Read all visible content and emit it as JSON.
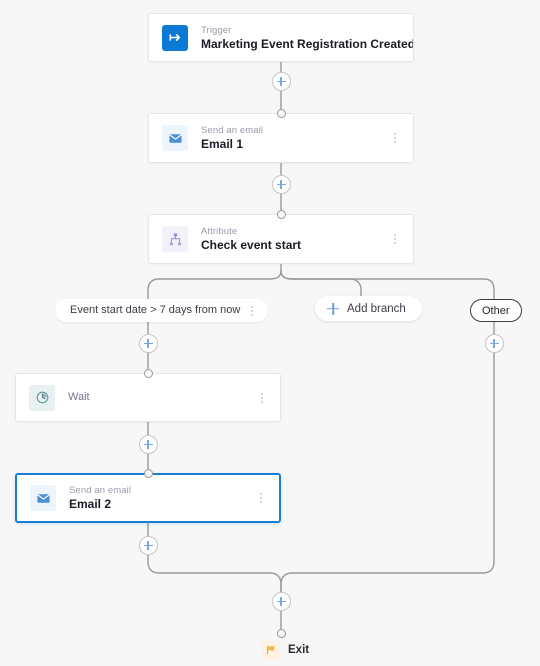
{
  "canvas": {
    "background": "#f7f7f7",
    "accent": "#0a7ad4",
    "plus_color": "#7ba7e0",
    "connector_color": "#9a9a9a"
  },
  "nodes": [
    {
      "id": "trigger",
      "kind": "Trigger",
      "title": "Marketing Event Registration Created",
      "icon": "trigger-arrow-icon",
      "icon_bg": "#0a7ad4",
      "has_kebab": false,
      "selected": false
    },
    {
      "id": "email-1",
      "kind": "Send an email",
      "title": "Email 1",
      "icon": "envelope-icon",
      "icon_bg": "#eef4fb",
      "has_kebab": true,
      "selected": false
    },
    {
      "id": "attribute",
      "kind": "Attribute",
      "title": "Check event start",
      "icon": "hierarchy-icon",
      "icon_bg": "#f2f1fa",
      "has_kebab": true,
      "selected": false
    },
    {
      "id": "wait",
      "kind": "",
      "title": "Wait",
      "icon": "clock-icon",
      "icon_bg": "#e7f1f1",
      "has_kebab": true,
      "selected": false
    },
    {
      "id": "email-2",
      "kind": "Send an email",
      "title": "Email 2",
      "icon": "envelope-icon",
      "icon_bg": "#eef4fb",
      "has_kebab": true,
      "selected": true
    }
  ],
  "branches": {
    "condition_label": "Event start date > 7 days from now",
    "add_branch_label": "Add branch",
    "other_label": "Other"
  },
  "exit": {
    "label": "Exit",
    "icon": "flag-icon",
    "icon_bg": "#fdf3e0",
    "flag_color": "#f0a530"
  },
  "add_step_buttons": [
    {
      "name": "add-step-after-trigger"
    },
    {
      "name": "add-step-after-email-1"
    },
    {
      "name": "add-step-after-condition-branch"
    },
    {
      "name": "add-step-after-wait"
    },
    {
      "name": "add-step-after-email-2"
    },
    {
      "name": "add-step-after-other-branch"
    },
    {
      "name": "add-step-before-exit"
    }
  ]
}
